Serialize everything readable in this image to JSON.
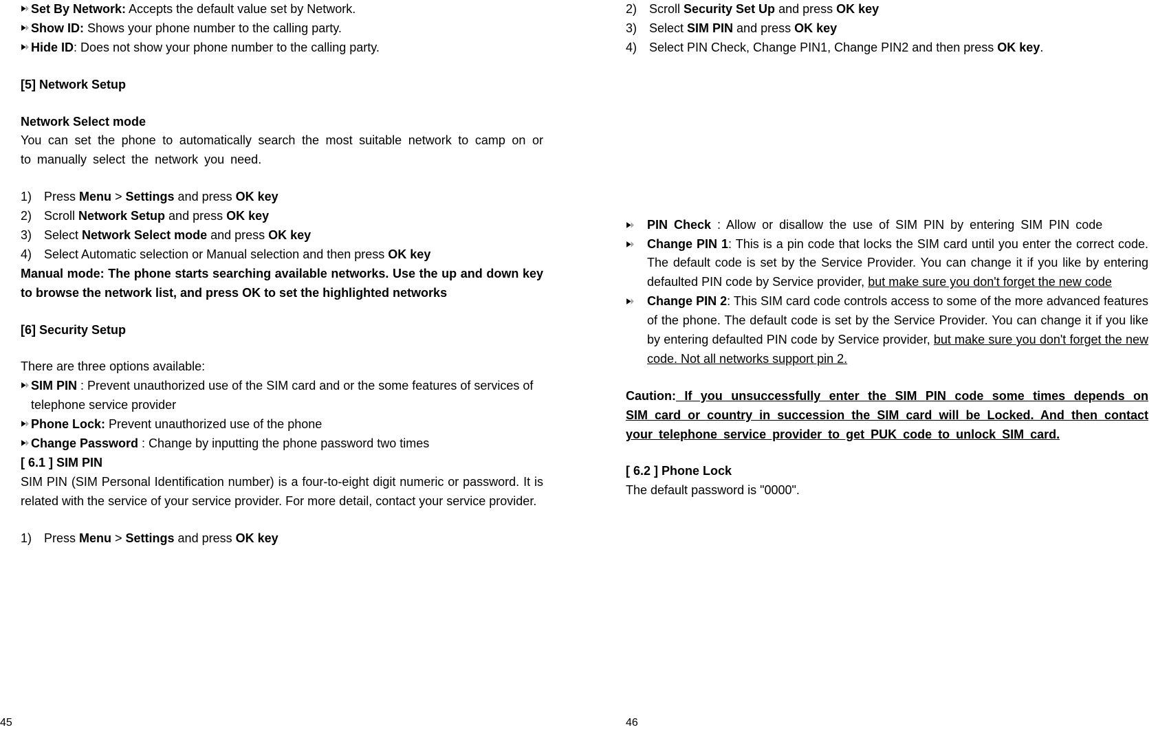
{
  "left": {
    "bullets_top": [
      {
        "bold": "Set By Network:",
        "rest": " Accepts the default value set by Network."
      },
      {
        "bold": "Show ID:",
        "rest": " Shows your phone number to the calling party."
      },
      {
        "bold": "Hide ID",
        "rest": ": Does not show your phone number to the calling party."
      }
    ],
    "sec5_head": "[5]    Network Setup",
    "nsm_head": "Network Select mode",
    "nsm_body": "You can set the phone to automatically search the most suitable network to camp on or to manually select the network you need.",
    "steps1": {
      "s1a": "Press ",
      "s1b": "Menu",
      "s1c": " > ",
      "s1d": "Settings",
      "s1e": " and press ",
      "s1f": "OK key",
      "s2a": "Scroll ",
      "s2b": "Network Setup",
      "s2c": " and press ",
      "s2d": "OK key",
      "s3a": "Select ",
      "s3b": "Network Select mode",
      "s3c": " and press ",
      "s3d": "OK key",
      "s4a": "Select Automatic selection or Manual selection and then press ",
      "s4b": "OK key"
    },
    "manual_note": "Manual mode: The phone starts searching available networks. Use the up and down key to browse the network list, and press OK to set the highlighted networks",
    "sec6_head": "[6]    Security Setup",
    "three_opts": "There are three options available:",
    "bullets_sec6": {
      "b1a": "SIM PIN",
      "b1b": " : Prevent unauthorized use of the SIM card and or the some features of services of telephone service provider",
      "b2a": "Phone Lock:",
      "b2b": " Prevent unauthorized use of the phone",
      "b3a": "Change Password",
      "b3b": " : Change by inputting the phone password   two times"
    },
    "s61_head": "[ 6.1 ]   SIM PIN",
    "s61_body": "SIM PIN (SIM Personal Identification number) is a four-to-eight digit numeric or password. It is related with the service of your service provider. For more detail, contact your service provider.",
    "steps2": {
      "s1a": "Press ",
      "s1b": "Menu",
      "s1c": " > ",
      "s1d": "Settings",
      "s1e": " and press ",
      "s1f": "OK key"
    },
    "pageno": "45"
  },
  "right": {
    "steps": {
      "s2a": "Scroll ",
      "s2b": "Security Set Up",
      "s2c": " and press ",
      "s2d": "OK key",
      "s3a": "Select ",
      "s3b": "SIM PIN",
      "s3c": " and press ",
      "s3d": "OK key",
      "s4a": "Select PIN Check, Change PIN1, Change PIN2 and then press ",
      "s4b": "OK key",
      "s4c": "."
    },
    "bul": {
      "b1a": "PIN Check",
      "b1b": " : Allow or disallow the use of SIM PIN by entering SIM PIN code",
      "b2a": "Change PIN 1",
      "b2b": ": This is a pin code that locks the SIM card until you enter the correct code. The default code is set by the Service Provider. You can change it if you like by entering defaulted PIN code by Service provider, ",
      "b2c": "but make sure you don't forget the new code",
      "b3a": "Change PIN 2",
      "b3b": ": This SIM card code controls access to some of the more advanced features of the phone. The default code is set by the Service Provider. You can change it if you like by entering defaulted PIN code by Service provider, ",
      "b3c": "but make sure you don't forget the new code. Not all networks support pin 2."
    },
    "caution_label": "Caution:",
    "caution_body1": " If you unsuccessfully enter the SIM PIN code some times depends on SIM card or country in succession  the SIM card ",
    "caution_body2": "will be Locked. And then contact your telephone service provider to get PUK code to unlock SIM card.",
    "s62_head": "[ 6.2 ]   Phone Lock",
    "s62_body": "The default password is \"0000\".",
    "pageno": "46"
  },
  "nums": {
    "n1": "1)",
    "n2": "2)",
    "n3": "3)",
    "n4": "4)"
  }
}
